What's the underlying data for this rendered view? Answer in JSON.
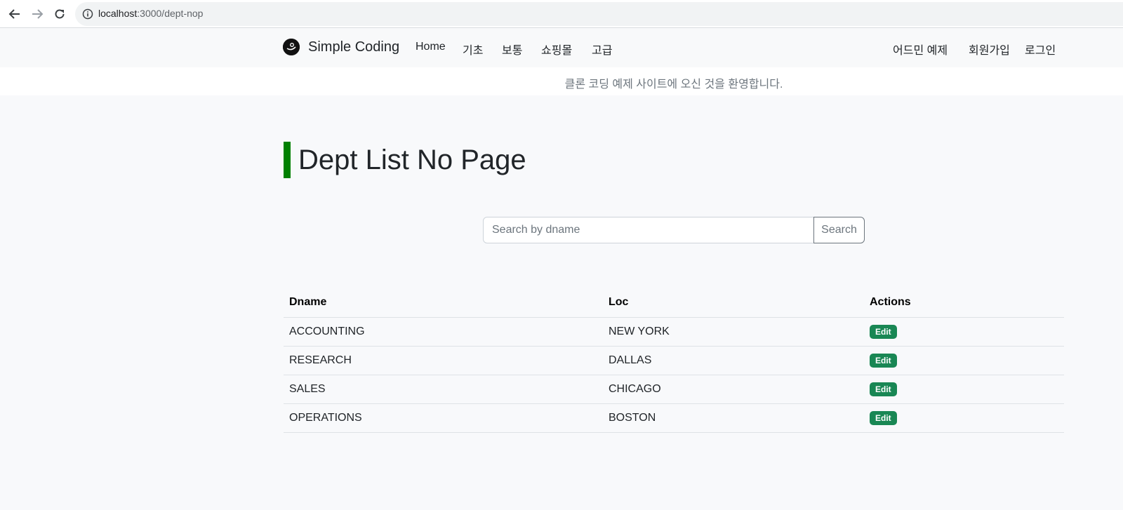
{
  "browser": {
    "url_host": "localhost",
    "url_path": ":3000/dept-nop"
  },
  "navbar": {
    "brand": "Simple Coding",
    "left_items": [
      "Home",
      "기초",
      "보통",
      "쇼핑몰",
      "고급"
    ],
    "right_items": [
      "어드민 예제",
      "회원가입",
      "로그인"
    ]
  },
  "welcome": "클론 코딩 예제 사이트에 오신 것을 환영합니다.",
  "page": {
    "title": "Dept List No Page"
  },
  "search": {
    "placeholder": "Search by dname",
    "value": "",
    "button_label": "Search"
  },
  "table": {
    "headers": [
      "Dname",
      "Loc",
      "Actions"
    ],
    "rows": [
      {
        "dname": "ACCOUNTING",
        "loc": "NEW YORK",
        "action": "Edit"
      },
      {
        "dname": "RESEARCH",
        "loc": "DALLAS",
        "action": "Edit"
      },
      {
        "dname": "SALES",
        "loc": "CHICAGO",
        "action": "Edit"
      },
      {
        "dname": "OPERATIONS",
        "loc": "BOSTON",
        "action": "Edit"
      }
    ]
  },
  "colors": {
    "title_accent": "#008000",
    "edit_badge": "#198754"
  },
  "icons": {
    "back": "arrow-left-icon",
    "forward": "arrow-right-icon",
    "reload": "reload-icon",
    "site_info": "info-icon",
    "brand_logo": "logo-icon"
  }
}
